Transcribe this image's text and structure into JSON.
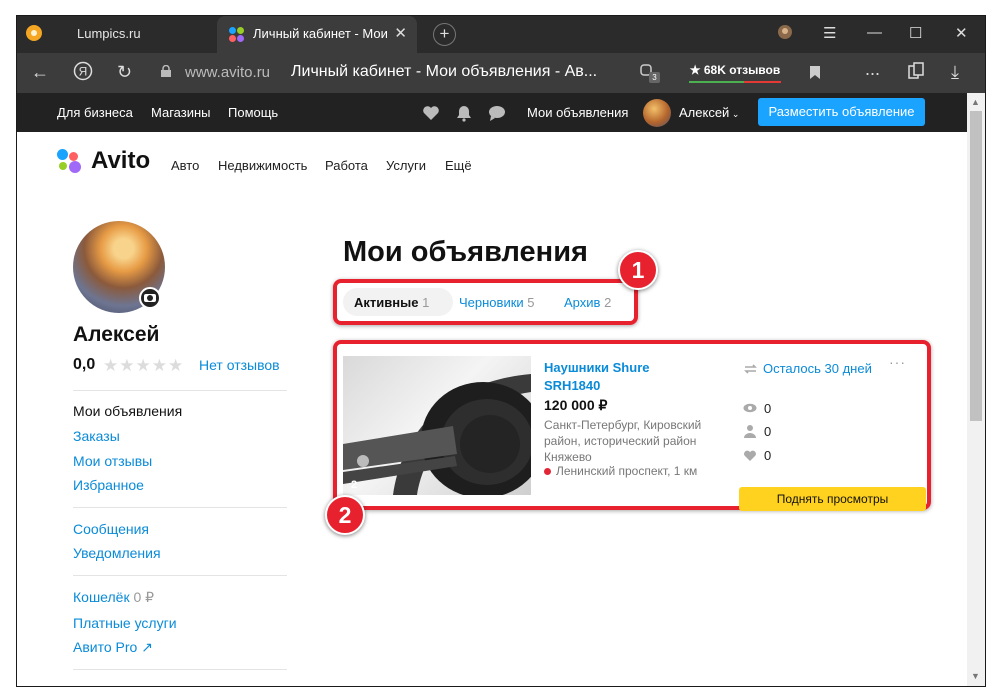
{
  "browser": {
    "tab1_title": "Lumpics.ru",
    "tab2_title": "Личный кабинет - Мои",
    "address_domain": "www.avito.ru",
    "address_title": "Личный кабинет - Мои объявления - Ав...",
    "rating": "★ 68K отзывов",
    "extension_count": "3",
    "more_dots": "..."
  },
  "avito_top": {
    "for_business": "Для бизнеса",
    "shops": "Магазины",
    "help": "Помощь",
    "my_ads": "Мои объявления",
    "user_name": "Алексей",
    "post_button": "Разместить объявление"
  },
  "nav": {
    "logo": "Avito",
    "items": [
      "Авто",
      "Недвижимость",
      "Работа",
      "Услуги",
      "Ещё"
    ]
  },
  "profile": {
    "name": "Алексей",
    "score": "0,0",
    "stars": "★★★★★",
    "reviews_link": "Нет отзывов"
  },
  "sidebar": {
    "my_ads": "Мои объявления",
    "orders": "Заказы",
    "my_reviews": "Мои отзывы",
    "favorites": "Избранное",
    "messages": "Сообщения",
    "notifications": "Уведомления",
    "wallet": "Кошелёк",
    "wallet_amount": "0 ₽",
    "paid_services": "Платные услуги",
    "avito_pro": "Авито Pro ↗"
  },
  "main": {
    "title": "Мои объявления",
    "tabs": [
      {
        "label": "Активные",
        "count": "1"
      },
      {
        "label": "Черновики",
        "count": "5"
      },
      {
        "label": "Архив",
        "count": "2"
      }
    ]
  },
  "listing": {
    "title": "Наушники Shure SRH1840",
    "price": "120 000 ₽",
    "address": "Санкт-Петербург, Кировский район, исторический район Княжево",
    "metro": "Ленинский проспект, 1 км",
    "days_left": "Осталось 30 дней",
    "more": "···",
    "views": "0",
    "contacts": "0",
    "favorites": "0",
    "photo_count": "2",
    "raise_button": "Поднять просмотры"
  },
  "annotations": {
    "badge1": "1",
    "badge2": "2"
  },
  "colors": {
    "accent_blue": "#0a8bd8",
    "post_button": "#1aa3ff",
    "raise_button": "#ffd21f",
    "annotation_red": "#e8212e"
  }
}
